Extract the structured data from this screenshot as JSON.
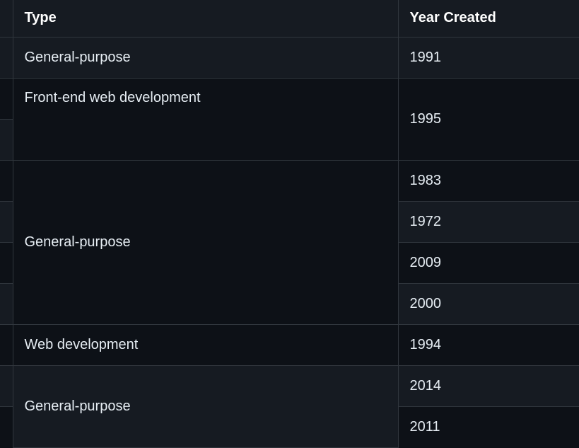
{
  "table": {
    "headers": {
      "type": "Type",
      "year": "Year Created"
    },
    "groups": [
      {
        "type": "General-purpose",
        "years": [
          "1991"
        ]
      },
      {
        "type": "Front-end web development",
        "years": [
          "1995",
          ""
        ]
      },
      {
        "type": "General-purpose",
        "years": [
          "1983",
          "1972",
          "2009",
          "2000"
        ]
      },
      {
        "type": "Web development",
        "years": [
          "1994"
        ]
      },
      {
        "type": "General-purpose",
        "years": [
          "2014",
          "2011"
        ]
      }
    ]
  }
}
